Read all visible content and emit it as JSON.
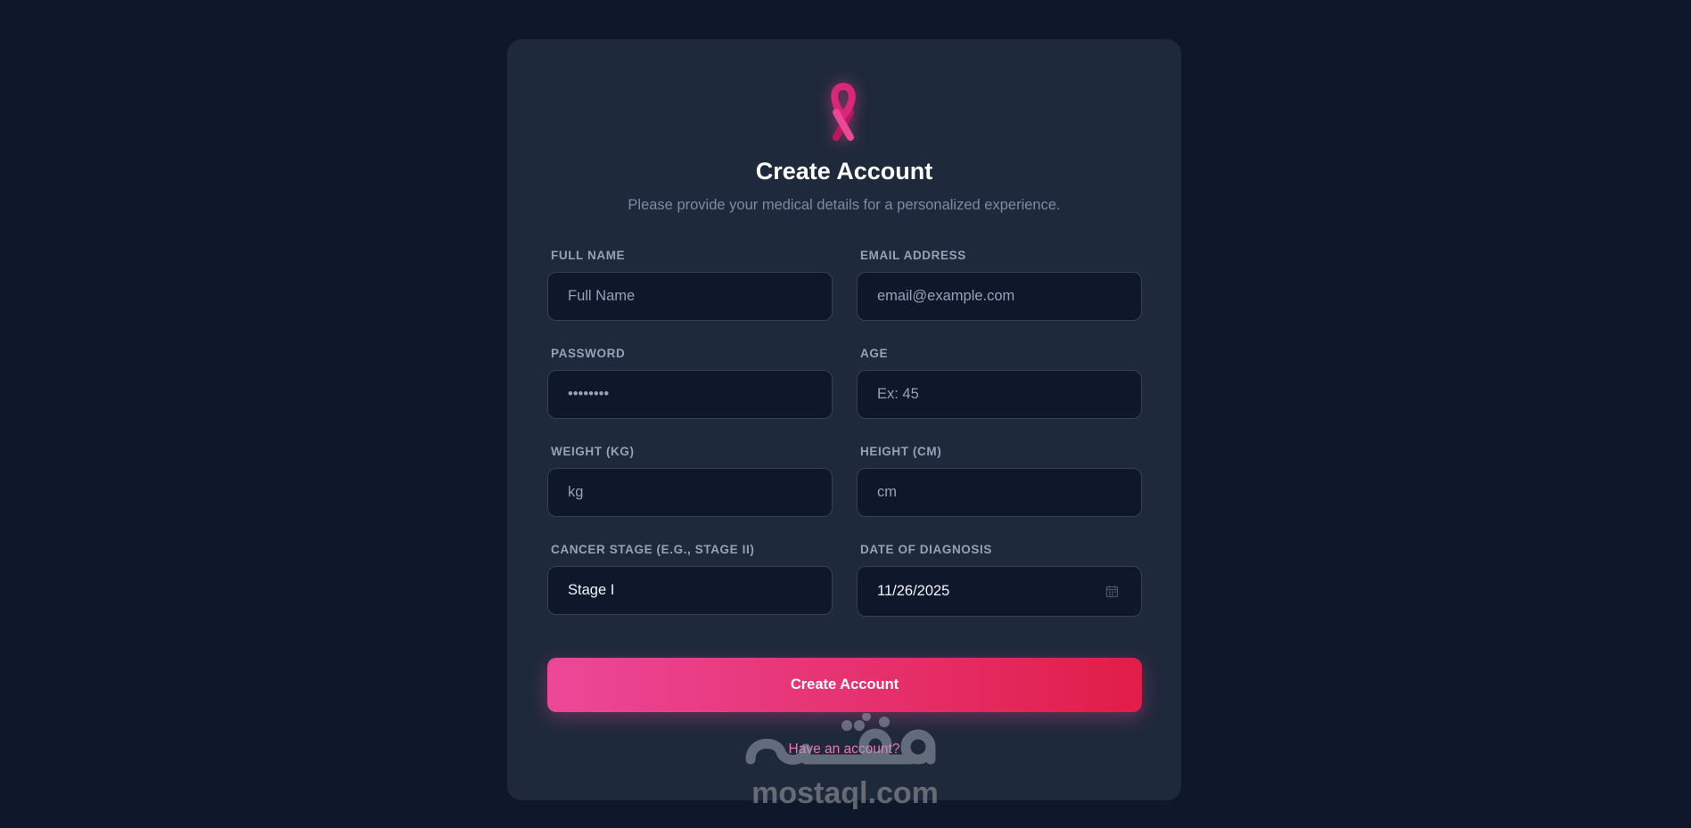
{
  "colors": {
    "page_background": "#0f172a",
    "card_background": "#1e293b",
    "accent": "#ec4899",
    "accent_end": "#e11d48",
    "link": "#f472b6"
  },
  "header": {
    "logo_icon": "awareness-ribbon-icon",
    "title": "Create Account",
    "subtitle": "Please provide your medical details for a personalized experience."
  },
  "form": {
    "full_name": {
      "label": "FULL NAME",
      "placeholder": "Full Name",
      "value": ""
    },
    "email": {
      "label": "EMAIL ADDRESS",
      "placeholder": "email@example.com",
      "value": ""
    },
    "password": {
      "label": "PASSWORD",
      "placeholder": "••••••••",
      "value": ""
    },
    "age": {
      "label": "AGE",
      "placeholder": "Ex: 45",
      "value": ""
    },
    "weight": {
      "label": "WEIGHT (KG)",
      "placeholder": "kg",
      "value": ""
    },
    "height": {
      "label": "HEIGHT (CM)",
      "placeholder": "cm",
      "value": ""
    },
    "cancer_stage": {
      "label": "CANCER STAGE (E.G., STAGE II)",
      "placeholder": "",
      "value": "Stage I"
    },
    "diagnosis_date": {
      "label": "DATE OF DIAGNOSIS",
      "value": "11/26/2025",
      "icon": "calendar-icon"
    },
    "submit_label": "Create Account",
    "signin_link": "Have an account?"
  },
  "watermark": {
    "text": "mostaql.com",
    "logo_text": "مستقل"
  }
}
